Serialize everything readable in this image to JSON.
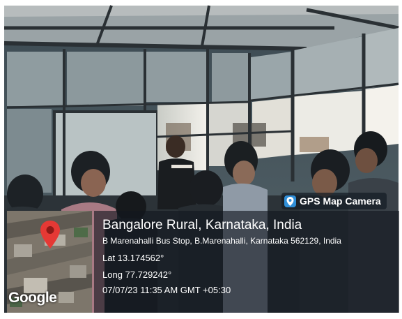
{
  "badge": {
    "label": "GPS Map Camera",
    "icon": "map-pin-camera-icon",
    "icon_color": "#2f8fd8"
  },
  "overlay": {
    "title": "Bangalore Rural, Karnataka, India",
    "address": "B Marenahalli Bus Stop, B.Marenahalli, Karnataka 562129, India",
    "latitude": "Lat 13.174562°",
    "longitude": "Long 77.729242°",
    "datetime": "07/07/23 11:35 AM GMT +05:30"
  },
  "map": {
    "attribution": "Google",
    "marker_icon": "location-pin-icon",
    "marker_color": "#e53935"
  }
}
